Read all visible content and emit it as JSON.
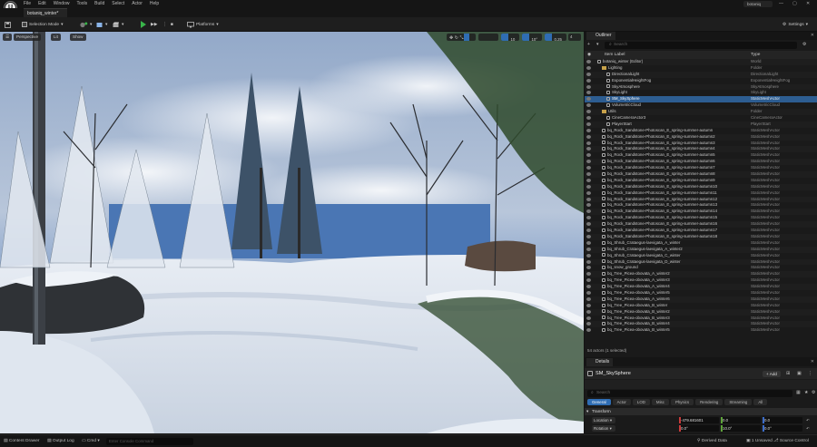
{
  "menubar": {
    "items": [
      "File",
      "Edit",
      "Window",
      "Tools",
      "Build",
      "Select",
      "Actor",
      "Help"
    ],
    "project_name": "botaniq"
  },
  "level_tab": {
    "label": "botaniq_winter*"
  },
  "toolbar": {
    "selection_mode": "Selection Mode",
    "platforms": "Platforms",
    "settings": "Settings"
  },
  "viewport": {
    "perspective": "Perspective",
    "lit": "Lit",
    "show": "Show",
    "grid_snap": "10",
    "rotation_snap": "10°",
    "scale_snap": "0.25",
    "camera_speed": "4"
  },
  "outliner": {
    "tab_label": "Outliner",
    "search_placeholder": "Search",
    "col_item_label": "Item Label",
    "col_type": "Type",
    "rows": [
      {
        "label": "botaniq_winter (Editor)",
        "type": "World",
        "indent": 0,
        "icon": "world"
      },
      {
        "label": "Lighting",
        "type": "Folder",
        "indent": 1,
        "icon": "folder"
      },
      {
        "label": "DirectionalLight",
        "type": "DirectionalLight",
        "indent": 2,
        "icon": "actor"
      },
      {
        "label": "ExponentialHeightFog",
        "type": "ExponentialHeightFog",
        "indent": 2,
        "icon": "actor"
      },
      {
        "label": "SkyAtmosphere",
        "type": "SkyAtmosphere",
        "indent": 2,
        "icon": "actor"
      },
      {
        "label": "SkyLight",
        "type": "SkyLight",
        "indent": 2,
        "icon": "actor"
      },
      {
        "label": "SM_SkySphere",
        "type": "StaticMeshActor",
        "indent": 2,
        "icon": "actor",
        "selected": true
      },
      {
        "label": "VolumetricCloud",
        "type": "VolumetricCloud",
        "indent": 2,
        "icon": "actor"
      },
      {
        "label": "Utils",
        "type": "Folder",
        "indent": 1,
        "icon": "folder"
      },
      {
        "label": "CineCameraActor3",
        "type": "CineCameraActor",
        "indent": 2,
        "icon": "actor"
      },
      {
        "label": "PlayerStart",
        "type": "PlayerStart",
        "indent": 2,
        "icon": "actor"
      },
      {
        "label": "bq_Rock_Sandstone-Photoscan_E_spring-summer-autumn",
        "type": "StaticMeshActor",
        "indent": 1,
        "icon": "actor"
      },
      {
        "label": "bq_Rock_Sandstone-Photoscan_E_spring-summer-autumn2",
        "type": "StaticMeshActor",
        "indent": 1,
        "icon": "actor"
      },
      {
        "label": "bq_Rock_Sandstone-Photoscan_E_spring-summer-autumn3",
        "type": "StaticMeshActor",
        "indent": 1,
        "icon": "actor"
      },
      {
        "label": "bq_Rock_Sandstone-Photoscan_E_spring-summer-autumn4",
        "type": "StaticMeshActor",
        "indent": 1,
        "icon": "actor"
      },
      {
        "label": "bq_Rock_Sandstone-Photoscan_E_spring-summer-autumn5",
        "type": "StaticMeshActor",
        "indent": 1,
        "icon": "actor"
      },
      {
        "label": "bq_Rock_Sandstone-Photoscan_E_spring-summer-autumn6",
        "type": "StaticMeshActor",
        "indent": 1,
        "icon": "actor"
      },
      {
        "label": "bq_Rock_Sandstone-Photoscan_E_spring-summer-autumn7",
        "type": "StaticMeshActor",
        "indent": 1,
        "icon": "actor"
      },
      {
        "label": "bq_Rock_Sandstone-Photoscan_E_spring-summer-autumn8",
        "type": "StaticMeshActor",
        "indent": 1,
        "icon": "actor"
      },
      {
        "label": "bq_Rock_Sandstone-Photoscan_E_spring-summer-autumn9",
        "type": "StaticMeshActor",
        "indent": 1,
        "icon": "actor"
      },
      {
        "label": "bq_Rock_Sandstone-Photoscan_E_spring-summer-autumn10",
        "type": "StaticMeshActor",
        "indent": 1,
        "icon": "actor"
      },
      {
        "label": "bq_Rock_Sandstone-Photoscan_E_spring-summer-autumn11",
        "type": "StaticMeshActor",
        "indent": 1,
        "icon": "actor"
      },
      {
        "label": "bq_Rock_Sandstone-Photoscan_E_spring-summer-autumn12",
        "type": "StaticMeshActor",
        "indent": 1,
        "icon": "actor"
      },
      {
        "label": "bq_Rock_Sandstone-Photoscan_E_spring-summer-autumn13",
        "type": "StaticMeshActor",
        "indent": 1,
        "icon": "actor"
      },
      {
        "label": "bq_Rock_Sandstone-Photoscan_E_spring-summer-autumn14",
        "type": "StaticMeshActor",
        "indent": 1,
        "icon": "actor"
      },
      {
        "label": "bq_Rock_Sandstone-Photoscan_E_spring-summer-autumn15",
        "type": "StaticMeshActor",
        "indent": 1,
        "icon": "actor"
      },
      {
        "label": "bq_Rock_Sandstone-Photoscan_E_spring-summer-autumn16",
        "type": "StaticMeshActor",
        "indent": 1,
        "icon": "actor"
      },
      {
        "label": "bq_Rock_Sandstone-Photoscan_E_spring-summer-autumn17",
        "type": "StaticMeshActor",
        "indent": 1,
        "icon": "actor"
      },
      {
        "label": "bq_Rock_Sandstone-Photoscan_E_spring-summer-autumn18",
        "type": "StaticMeshActor",
        "indent": 1,
        "icon": "actor"
      },
      {
        "label": "bq_Shrub_Crataegus-laevigata_A_winter",
        "type": "StaticMeshActor",
        "indent": 1,
        "icon": "actor"
      },
      {
        "label": "bq_Shrub_Crataegus-laevigata_A_winter2",
        "type": "StaticMeshActor",
        "indent": 1,
        "icon": "actor"
      },
      {
        "label": "bq_Shrub_Crataegus-laevigata_C_winter",
        "type": "StaticMeshActor",
        "indent": 1,
        "icon": "actor"
      },
      {
        "label": "bq_Shrub_Crataegus-laevigata_D_winter",
        "type": "StaticMeshActor",
        "indent": 1,
        "icon": "actor"
      },
      {
        "label": "bq_snow_ground",
        "type": "StaticMeshActor",
        "indent": 1,
        "icon": "actor"
      },
      {
        "label": "bq_Tree_Picea-obovata_A_winter2",
        "type": "StaticMeshActor",
        "indent": 1,
        "icon": "actor"
      },
      {
        "label": "bq_Tree_Picea-obovata_A_winter3",
        "type": "StaticMeshActor",
        "indent": 1,
        "icon": "actor"
      },
      {
        "label": "bq_Tree_Picea-obovata_A_winter4",
        "type": "StaticMeshActor",
        "indent": 1,
        "icon": "actor"
      },
      {
        "label": "bq_Tree_Picea-obovata_A_winter5",
        "type": "StaticMeshActor",
        "indent": 1,
        "icon": "actor"
      },
      {
        "label": "bq_Tree_Picea-obovata_A_winter6",
        "type": "StaticMeshActor",
        "indent": 1,
        "icon": "actor"
      },
      {
        "label": "bq_Tree_Picea-obovata_B_winter",
        "type": "StaticMeshActor",
        "indent": 1,
        "icon": "actor"
      },
      {
        "label": "bq_Tree_Picea-obovata_B_winter2",
        "type": "StaticMeshActor",
        "indent": 1,
        "icon": "actor"
      },
      {
        "label": "bq_Tree_Picea-obovata_B_winter3",
        "type": "StaticMeshActor",
        "indent": 1,
        "icon": "actor"
      },
      {
        "label": "bq_Tree_Picea-obovata_B_winter4",
        "type": "StaticMeshActor",
        "indent": 1,
        "icon": "actor"
      },
      {
        "label": "bq_Tree_Picea-obovata_B_winter5",
        "type": "StaticMeshActor",
        "indent": 1,
        "icon": "actor"
      }
    ],
    "status": "54 actors (1 selected)"
  },
  "details": {
    "tab_label": "Details",
    "selected_actor": "SM_SkySphere",
    "add_button": "+ Add",
    "search_placeholder": "Search",
    "filter_tabs": [
      "General",
      "Actor",
      "LOD",
      "Misc",
      "Physics",
      "Rendering",
      "Streaming",
      "All"
    ],
    "section": "Transform",
    "location": {
      "label": "Location",
      "x": "-479.681601",
      "y": "0.0",
      "z": "0.0"
    },
    "rotation": {
      "label": "Rotation",
      "x": "0.0°",
      "y": "10.0°",
      "z": "0.0°"
    }
  },
  "statusbar": {
    "content_drawer": "Content Drawer",
    "output_log": "Output Log",
    "cmd": "Cmd",
    "console_placeholder": "Enter Console Command",
    "derived_data": "Derived Data",
    "unsaved": "1 Unsaved",
    "source_control": "Source Control"
  },
  "colors": {
    "accent": "#2f6db3",
    "selected_row": "#2d5d91",
    "play_green": "#39b54a",
    "panel_bg": "#1a1a1a"
  }
}
